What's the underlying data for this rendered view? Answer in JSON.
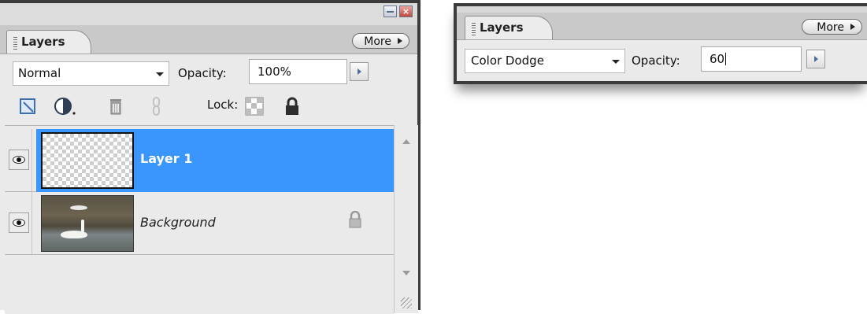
{
  "left_panel": {
    "tab_label": "Layers",
    "more_label": "More",
    "blend_mode": "Normal",
    "opacity_label": "Opacity:",
    "opacity_value": "100%",
    "lock_label": "Lock:",
    "layers": [
      {
        "name": "Layer 1",
        "selected": true
      },
      {
        "name": "Background",
        "selected": false,
        "locked": true
      }
    ],
    "selection_color": "#3a95fc"
  },
  "right_panel": {
    "tab_label": "Layers",
    "more_label": "More",
    "blend_mode": "Color Dodge",
    "opacity_label": "Opacity:",
    "opacity_value": "60"
  }
}
